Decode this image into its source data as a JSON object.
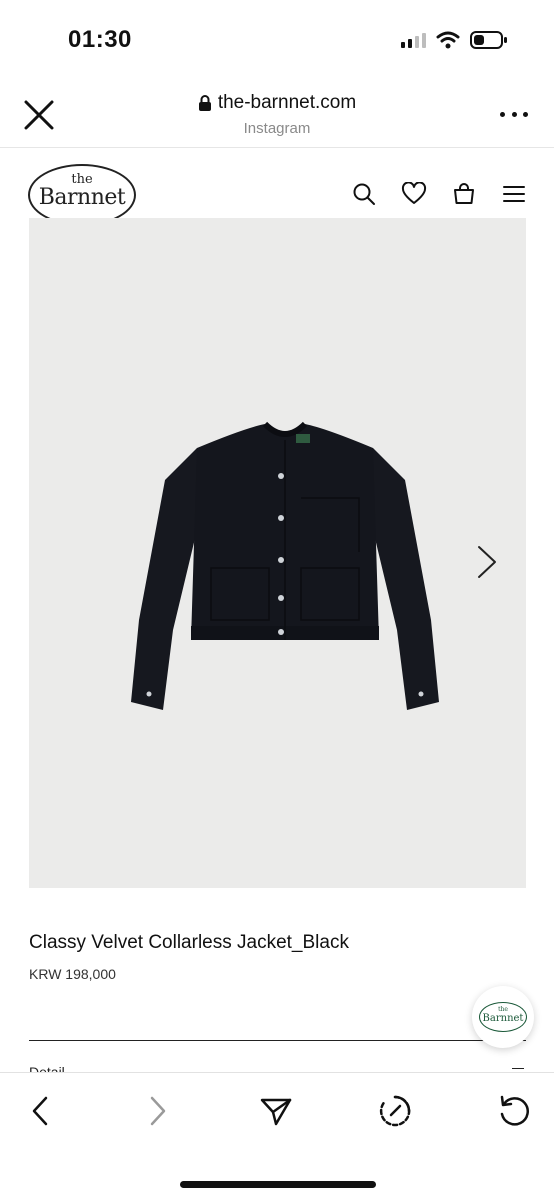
{
  "status_bar": {
    "time": "01:30",
    "icons": [
      "signal-icon",
      "wifi-icon",
      "battery-icon"
    ]
  },
  "browser": {
    "domain": "the-barnnet.com",
    "source": "Instagram",
    "icons": [
      "close-icon",
      "lock-icon",
      "more-icon"
    ]
  },
  "site": {
    "logo_the": "the",
    "logo_name": "Barnnet",
    "icons": [
      "search-icon",
      "heart-icon",
      "bag-icon",
      "menu-icon"
    ]
  },
  "product": {
    "name": "Classy Velvet Collarless Jacket_Black",
    "price": "KRW 198,000",
    "detail_label": "Detail"
  },
  "toolbar": {
    "icons": [
      "back-icon",
      "forward-icon",
      "share-icon",
      "speed-icon",
      "reload-icon"
    ]
  },
  "colors": {
    "image_background": "#ebebea",
    "jacket": "#14161d",
    "badge_green": "#1c5a3a"
  }
}
